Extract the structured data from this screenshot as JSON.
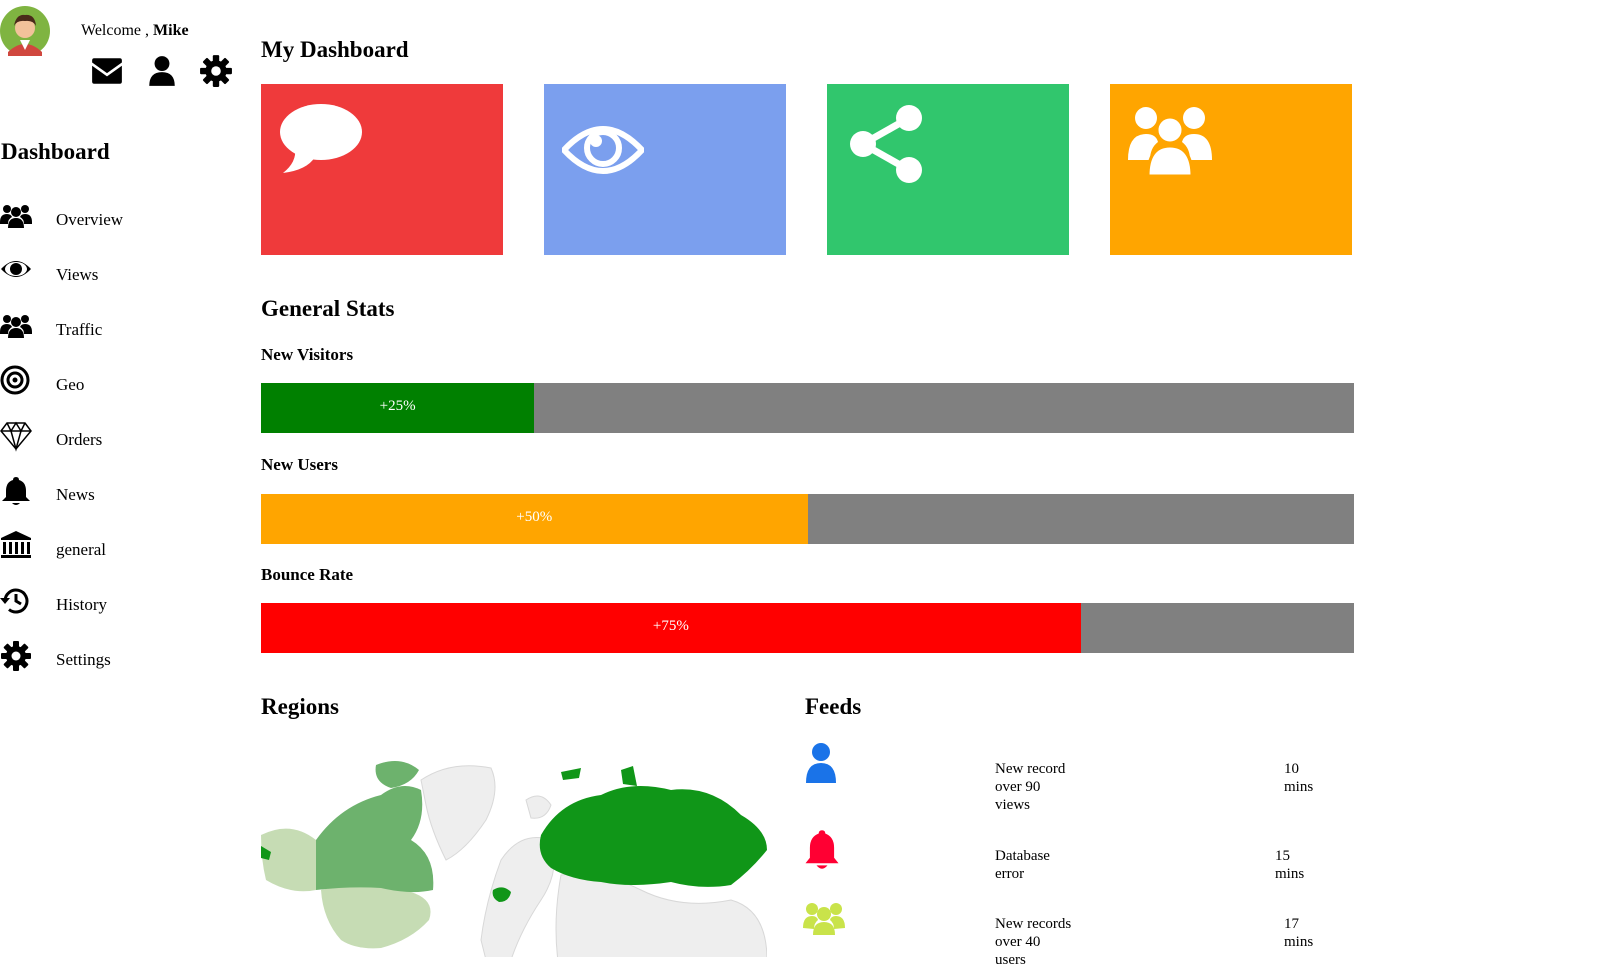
{
  "sidebar": {
    "welcome_prefix": "Welcome ,",
    "user_name": "Mike",
    "title": "Dashboard",
    "items": [
      {
        "label": "Overview",
        "icon": "users-icon"
      },
      {
        "label": "Views",
        "icon": "eye-icon"
      },
      {
        "label": "Traffic",
        "icon": "users-icon"
      },
      {
        "label": "Geo",
        "icon": "bullseye-icon"
      },
      {
        "label": "Orders",
        "icon": "diamond-icon"
      },
      {
        "label": "News",
        "icon": "bell-icon"
      },
      {
        "label": "general",
        "icon": "bank-icon"
      },
      {
        "label": "History",
        "icon": "history-icon"
      },
      {
        "label": "Settings",
        "icon": "gear-icon"
      }
    ],
    "top_icons": [
      "envelope-icon",
      "user-icon",
      "gear-icon"
    ]
  },
  "main": {
    "title": "My Dashboard",
    "tiles": [
      {
        "icon": "comment-icon",
        "color": "#ef3a3b"
      },
      {
        "icon": "eye-icon",
        "color": "#7b9fee"
      },
      {
        "icon": "share-icon",
        "color": "#31c66d"
      },
      {
        "icon": "users-icon",
        "color": "#ffa500"
      }
    ],
    "stats_title": "General Stats",
    "stats": [
      {
        "label": "New Visitors",
        "value": "+25%",
        "fraction": 0.25,
        "color": "#008000"
      },
      {
        "label": "New Users",
        "value": "+50%",
        "fraction": 0.5,
        "color": "#ffa500"
      },
      {
        "label": "Bounce Rate",
        "value": "+75%",
        "fraction": 0.75,
        "color": "#ff0000"
      }
    ],
    "regions_title": "Regions",
    "feeds_title": "Feeds",
    "feeds": [
      {
        "icon": "user-icon",
        "color": "#1a73e8",
        "lines": [
          "New record",
          "over 90",
          "views"
        ],
        "time": [
          "10",
          "mins"
        ]
      },
      {
        "icon": "bell-icon",
        "color": "#ff0033",
        "lines": [
          "Database",
          "error"
        ],
        "time": [
          "15",
          "mins"
        ]
      },
      {
        "icon": "users-icon",
        "color": "#c9e34a",
        "lines": [
          "New records",
          "over 40",
          "users"
        ],
        "time": [
          "17",
          "mins"
        ]
      }
    ]
  },
  "colors": {
    "map_land": "#eeeeee",
    "map_light": "#c6dcb4",
    "map_mid": "#6db26d",
    "map_dark": "#109618"
  }
}
